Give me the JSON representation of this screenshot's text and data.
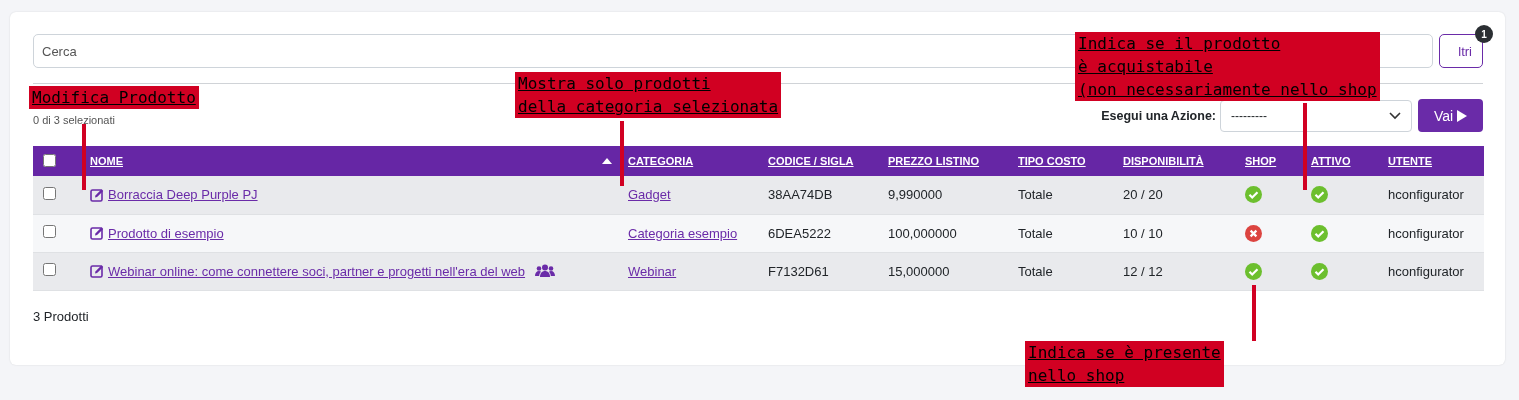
{
  "search": {
    "placeholder": "Cerca"
  },
  "filter_button": {
    "label": "ltri",
    "badge": "1"
  },
  "selection_count": "0 di 3 selezionati",
  "action": {
    "label": "Esegui una Azione:",
    "value": "---------",
    "button": "Vai"
  },
  "table": {
    "select_all_checked": false,
    "columns": [
      {
        "label": "NOME",
        "sorted": true
      },
      {
        "label": "CATEGORIA",
        "sorted": false
      },
      {
        "label": "CODICE / SIGLA",
        "sorted": false
      },
      {
        "label": "PREZZO LISTINO",
        "sorted": false
      },
      {
        "label": "TIPO COSTO",
        "sorted": false
      },
      {
        "label": "DISPONIBILITÀ",
        "sorted": false
      },
      {
        "label": "SHOP",
        "sorted": false
      },
      {
        "label": "ATTIVO",
        "sorted": false
      },
      {
        "label": "UTENTE",
        "sorted": false
      }
    ],
    "rows": [
      {
        "checked": false,
        "name": "Borraccia Deep Purple PJ",
        "group": false,
        "category": "Gadget",
        "code": "38AA74DB",
        "price": "9,990000",
        "cost_type": "Totale",
        "availability": "20 / 20",
        "shop": true,
        "active": true,
        "user": "hconfigurator"
      },
      {
        "checked": false,
        "name": "Prodotto di esempio",
        "group": false,
        "category": "Categoria esempio",
        "code": "6DEA5222",
        "price": "100,000000",
        "cost_type": "Totale",
        "availability": "10 / 10",
        "shop": false,
        "active": true,
        "user": "hconfigurator"
      },
      {
        "checked": false,
        "name": "Webinar online: come connettere soci, partner e progetti nell'era del web",
        "group": true,
        "category": "Webinar",
        "code": "F7132D61",
        "price": "15,000000",
        "cost_type": "Totale",
        "availability": "12 / 12",
        "shop": true,
        "active": true,
        "user": "hconfigurator"
      }
    ]
  },
  "footer": "3 Prodotti",
  "annotations": [
    {
      "lines": [
        "Modifica Prodotto"
      ]
    },
    {
      "lines": [
        "Mostra solo prodotti",
        "della categoria selezionata"
      ]
    },
    {
      "lines": [
        "Indica se il prodotto",
        "è acquistabile",
        "(non necessariamente nello shop"
      ]
    },
    {
      "lines": [
        "Indica se è presente",
        "nello shop"
      ]
    }
  ]
}
